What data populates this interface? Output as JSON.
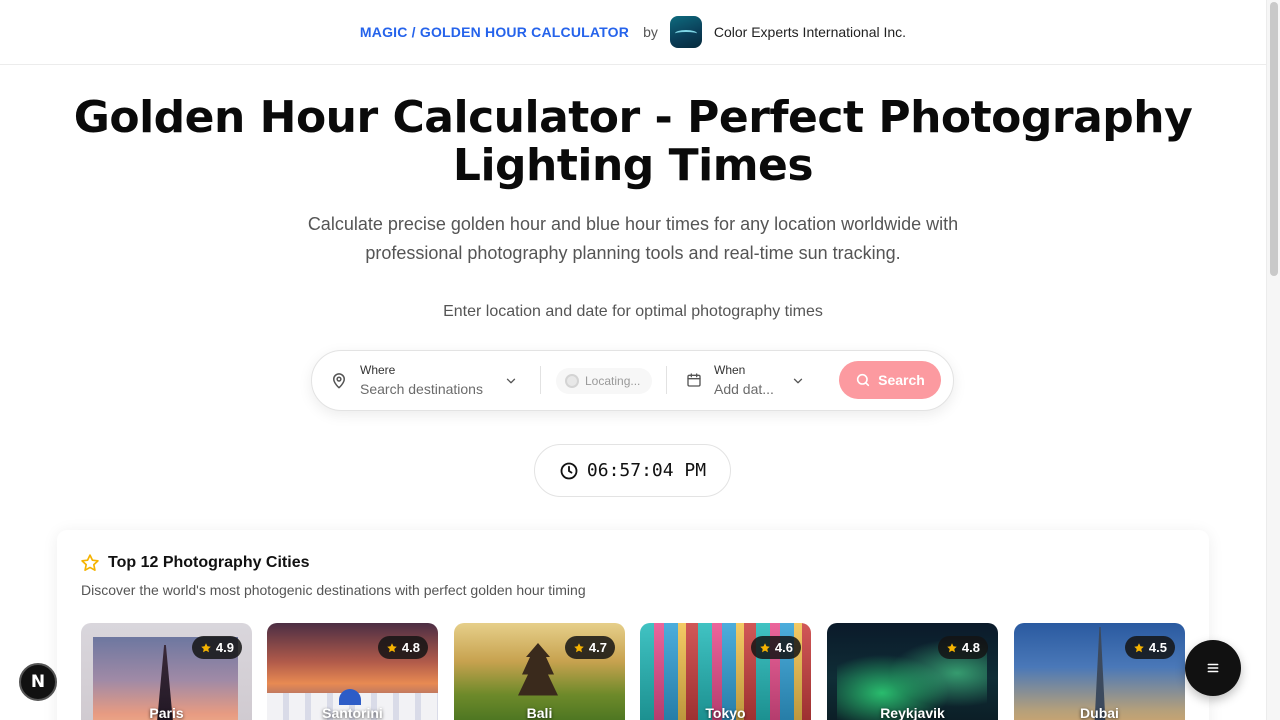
{
  "header": {
    "brand_link": "MAGIC / GOLDEN HOUR CALCULATOR",
    "by": "by",
    "company": "Color Experts International Inc."
  },
  "hero": {
    "title": "Golden Hour Calculator - Perfect Photography Lighting Times",
    "subtitle": "Calculate precise golden hour and blue hour times for any location worldwide with professional photography planning tools and real-time sun tracking.",
    "prompt": "Enter location and date for optimal photography times"
  },
  "search": {
    "where_label": "Where",
    "where_placeholder": "Search destinations",
    "locating": "Locating...",
    "when_label": "When",
    "when_placeholder": "Add dat...",
    "button": "Search"
  },
  "clock": {
    "time": "06:57:04 PM"
  },
  "cities": {
    "title": "Top 12 Photography Cities",
    "subtitle": "Discover the world's most photogenic destinations with perfect golden hour timing",
    "items": [
      {
        "name": "Paris",
        "rating": "4.9"
      },
      {
        "name": "Santorini",
        "rating": "4.8"
      },
      {
        "name": "Bali",
        "rating": "4.7"
      },
      {
        "name": "Tokyo",
        "rating": "4.6"
      },
      {
        "name": "Reykjavik",
        "rating": "4.8"
      },
      {
        "name": "Dubai",
        "rating": "4.5"
      }
    ]
  },
  "misc": {
    "next_badge": "N"
  },
  "colors": {
    "accent_blue": "#2563eb",
    "search_button": "#fc9aa0",
    "star_gold": "#f5b301"
  }
}
